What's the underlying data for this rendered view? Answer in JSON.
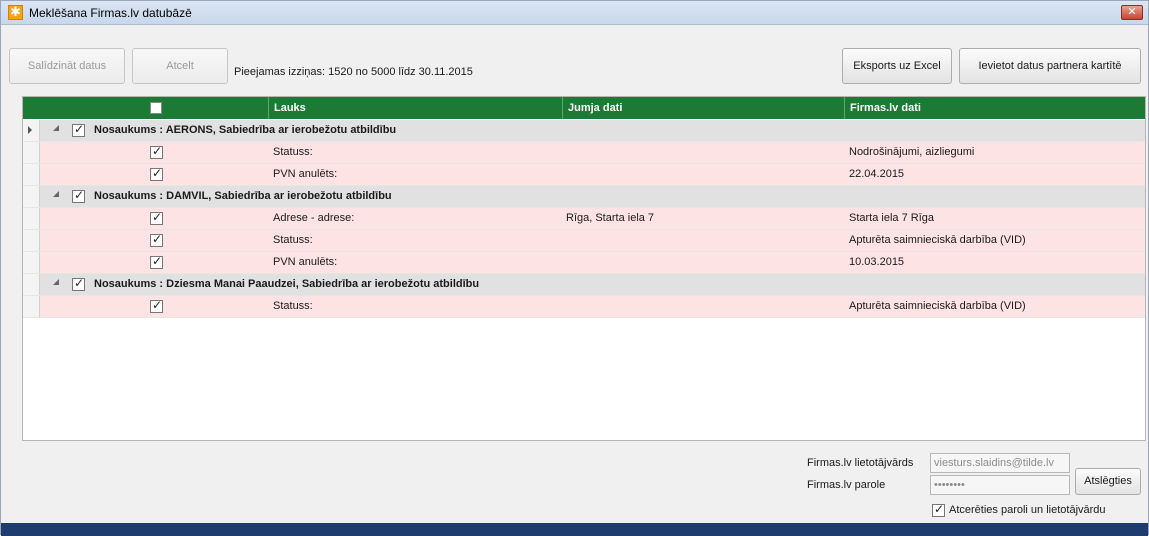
{
  "window": {
    "title": "Meklēšana Firmas.lv datubāzē",
    "close_glyph": "✕"
  },
  "toolbar": {
    "compare_label": "Salīdzināt datus",
    "cancel_label": "Atcelt",
    "info": "Pieejamas izziņas: 1520 no 5000 līdz 30.11.2015",
    "export_label": "Eksports uz Excel",
    "import_label": "Ievietot datus partnera kartītē"
  },
  "grid": {
    "columns": [
      "Lauks",
      "Jumja dati",
      "Firmas.lv dati"
    ],
    "groups": [
      {
        "title": "Nosaukums : AERONS, Sabiedrība ar ierobežotu atbildību",
        "rows": [
          {
            "field": "Statuss:",
            "local": "",
            "remote": "Nodrošinājumi, aizliegumi"
          },
          {
            "field": "PVN anulēts:",
            "local": "",
            "remote": "22.04.2015"
          }
        ]
      },
      {
        "title": "Nosaukums : DAMVIL, Sabiedrība ar ierobežotu atbildību",
        "rows": [
          {
            "field": "Adrese - adrese:",
            "local": "Rīga, Starta iela 7",
            "remote": "Starta iela 7 Rīga"
          },
          {
            "field": "Statuss:",
            "local": "",
            "remote": "Apturēta saimnieciskā darbība (VID)"
          },
          {
            "field": "PVN anulēts:",
            "local": "",
            "remote": "10.03.2015"
          }
        ]
      },
      {
        "title": "Nosaukums : Dziesma Manai Paaudzei, Sabiedrība ar ierobežotu atbildību",
        "rows": [
          {
            "field": "Statuss:",
            "local": "",
            "remote": "Apturēta saimnieciskā darbība (VID)"
          }
        ]
      }
    ]
  },
  "login": {
    "username_label": "Firmas.lv lietotājvārds",
    "username_value": "viesturs.slaidins@tilde.lv",
    "password_label": "Firmas.lv parole",
    "password_value": "••••••••",
    "disconnect_label": "Atslēgties",
    "remember_label": "Atcerēties paroli un lietotājvārdu"
  },
  "colors": {
    "header_green": "#1b7a33",
    "row_pink": "#fde3e3",
    "group_gray": "#e1e1e1"
  }
}
